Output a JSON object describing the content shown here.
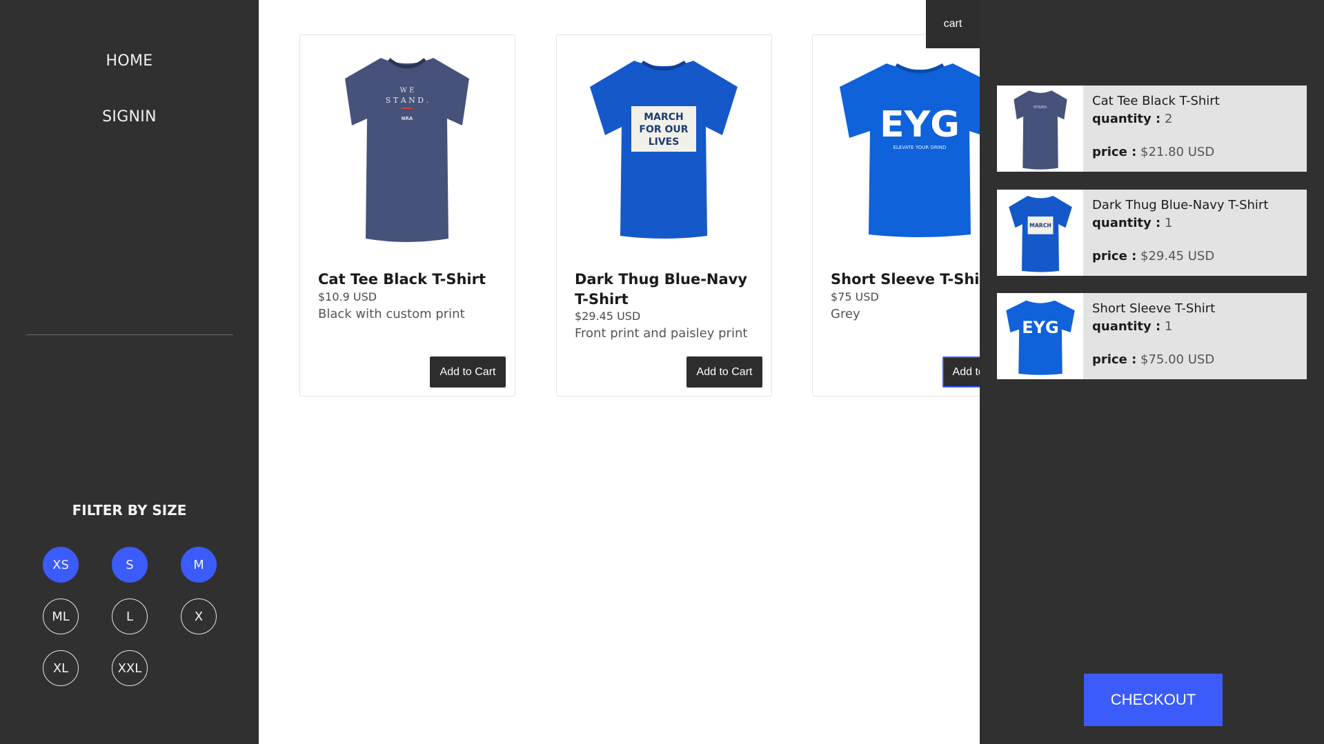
{
  "nav": {
    "home": "HOME",
    "signin": "SIGNIN"
  },
  "filter": {
    "title": "FILTER BY SIZE",
    "sizes": [
      {
        "label": "XS",
        "active": true
      },
      {
        "label": "S",
        "active": true
      },
      {
        "label": "M",
        "active": true
      },
      {
        "label": "ML",
        "active": false
      },
      {
        "label": "L",
        "active": false
      },
      {
        "label": "X",
        "active": false
      },
      {
        "label": "XL",
        "active": false
      },
      {
        "label": "XXL",
        "active": false
      }
    ]
  },
  "products": [
    {
      "title": "Cat Tee Black T-Shirt",
      "price": "$10.9 USD",
      "description": "Black with custom print",
      "button": "Add to Cart",
      "shirt_color": "#46527a",
      "print": "WE STAND."
    },
    {
      "title": "Dark Thug Blue-Navy T-Shirt",
      "price": "$29.45 USD",
      "description": "Front print and paisley print",
      "button": "Add to Cart",
      "shirt_color": "#1558c9",
      "print": "MARCH FOR OUR LIVES"
    },
    {
      "title": "Short Sleeve T-Shirt",
      "price": "$75 USD",
      "description": "Grey",
      "button": "Add to Cart",
      "shirt_color": "#0f62d9",
      "print": "EYG"
    }
  ],
  "cart": {
    "toggle_label": "cart",
    "quantity_label": "quantity :",
    "price_label": "price :",
    "items": [
      {
        "name": "Cat Tee Black T-Shirt",
        "quantity": "2",
        "price": "$21.80 USD"
      },
      {
        "name": "Dark Thug Blue-Navy T-Shirt",
        "quantity": "1",
        "price": "$29.45 USD"
      },
      {
        "name": "Short Sleeve T-Shirt",
        "quantity": "1",
        "price": "$75.00 USD"
      }
    ],
    "checkout_label": "CHECKOUT"
  },
  "colors": {
    "accent": "#3b5bfb",
    "sidebar_bg": "#303030",
    "button_bg": "#2d2d2d"
  }
}
